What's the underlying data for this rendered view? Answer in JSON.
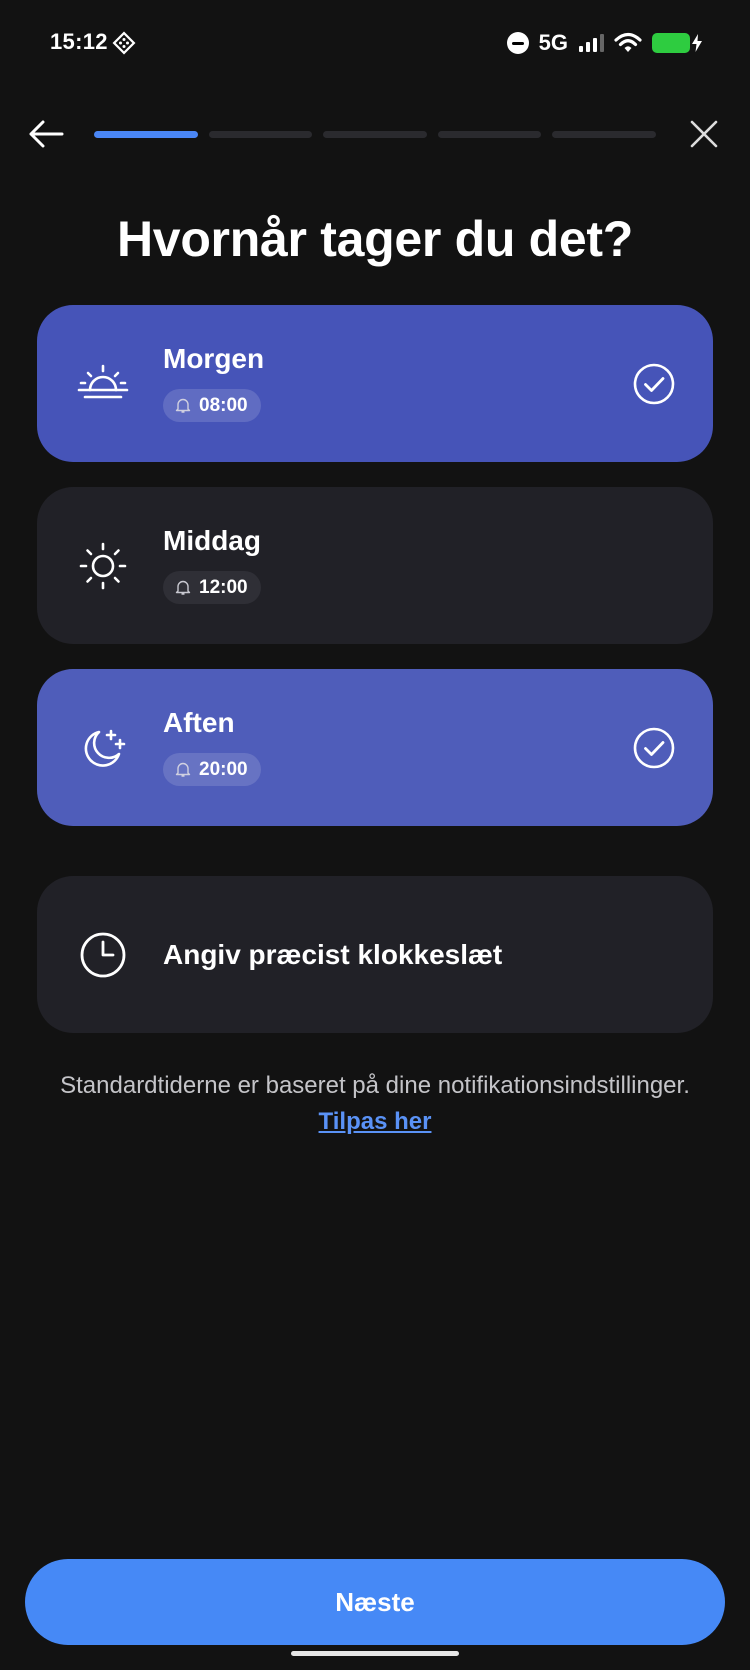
{
  "status_bar": {
    "time": "15:12",
    "network": "5G",
    "icons": [
      "app-diamond-icon",
      "do-not-disturb-icon",
      "signal-icon",
      "wifi-icon",
      "battery-charging-icon"
    ],
    "battery_color": "#2ecc40"
  },
  "progress": {
    "total_steps": 5,
    "current_step": 1,
    "active_color": "#4a86f5"
  },
  "title": "Hvornår tager du det?",
  "options": [
    {
      "label": "Morgen",
      "time": "08:00",
      "icon": "sunrise-icon",
      "selected": true
    },
    {
      "label": "Middag",
      "time": "12:00",
      "icon": "sun-icon",
      "selected": false
    },
    {
      "label": "Aften",
      "time": "20:00",
      "icon": "moon-icon",
      "selected": true
    },
    {
      "label": "Angiv præcist klokkeslæt",
      "icon": "clock-icon",
      "selected": false
    }
  ],
  "info": {
    "text": "Standardtiderne er baseret på dine notifikationsindstillinger.",
    "link": "Tilpas her"
  },
  "next_button": "Næste",
  "colors": {
    "accent": "#4689f6",
    "selected_card": "#4654b8",
    "card": "#212127",
    "background": "#121212"
  }
}
